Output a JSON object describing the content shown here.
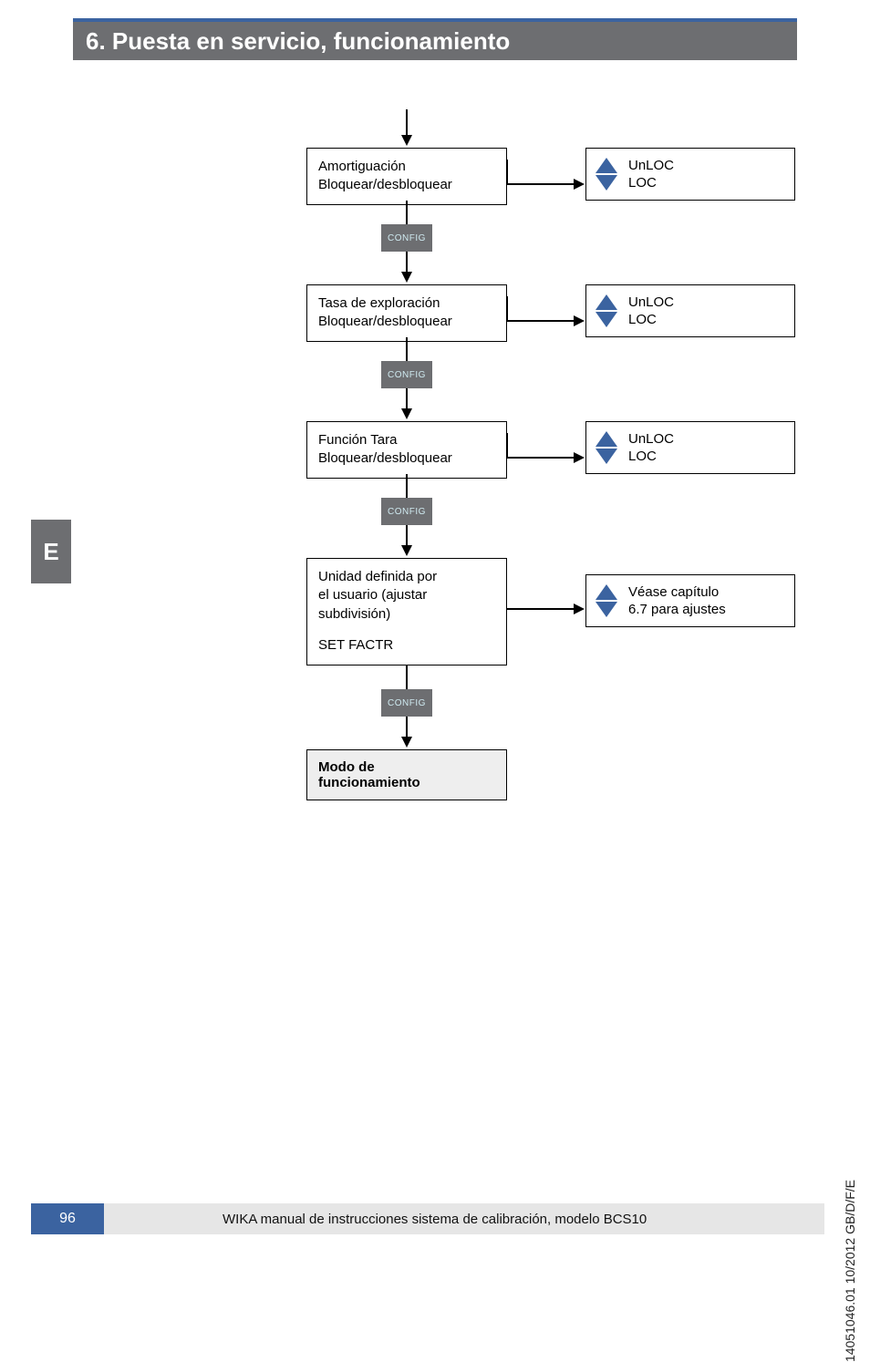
{
  "header": {
    "title": "6. Puesta en servicio, funcionamiento"
  },
  "lang_tab": "E",
  "diagram": {
    "config_label": "CONFIG",
    "steps": [
      {
        "line1": "Amortiguación",
        "line2": "Bloquear/desbloquear",
        "options": {
          "up": "UnLOC",
          "down": "LOC"
        }
      },
      {
        "line1": "Tasa de exploración",
        "line2": "Bloquear/desbloquear",
        "options": {
          "up": "UnLOC",
          "down": "LOC"
        }
      },
      {
        "line1": "Función Tara",
        "line2": "Bloquear/desbloquear",
        "options": {
          "up": "UnLOC",
          "down": "LOC"
        }
      },
      {
        "line1": "Unidad definida por",
        "line2": "el usuario (ajustar",
        "line3": "subdivisión)",
        "line4": "SET FACTR",
        "options": {
          "up": "Véase capítulo",
          "down": "6.7 para ajustes"
        }
      }
    ],
    "final": {
      "line1": "Modo de",
      "line2": "funcionamiento"
    }
  },
  "footer": {
    "page_number": "96",
    "text": "WIKA manual de instrucciones sistema de calibración, modelo BCS10"
  },
  "side_code": "14051046.01 10/2012 GB/D/F/E"
}
